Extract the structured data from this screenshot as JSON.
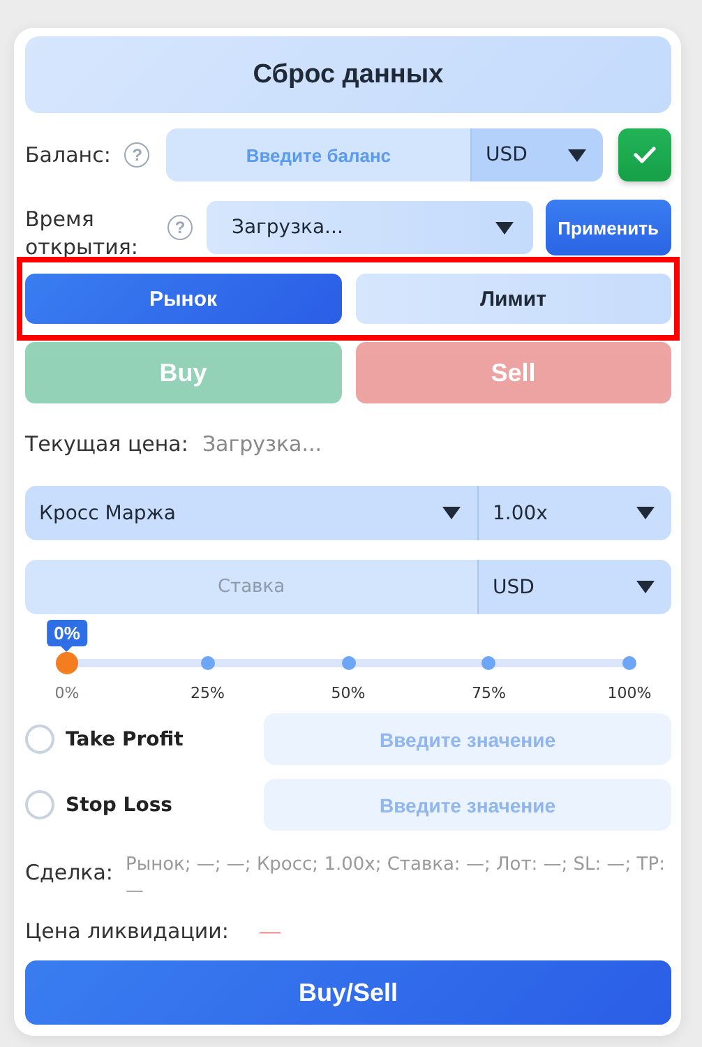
{
  "reset_button": "Сброс данных",
  "balance": {
    "label": "Баланс:",
    "help": "?",
    "placeholder": "Введите баланс",
    "currency": "USD"
  },
  "open_time": {
    "label": "Время открытия:",
    "help": "?",
    "value": "Загрузка...",
    "apply_button": "Применить"
  },
  "order_types_highlighted": true,
  "order_types": [
    {
      "label": "Рынок",
      "selected": true
    },
    {
      "label": "Лимит",
      "selected": false
    }
  ],
  "sides": [
    {
      "label": "Buy",
      "kind": "buy",
      "disabled": true
    },
    {
      "label": "Sell",
      "kind": "sell",
      "disabled": true
    }
  ],
  "current_price": {
    "label": "Текущая цена:",
    "value": "Загрузка..."
  },
  "margin": {
    "mode": "Кросс Маржа",
    "leverage": "1.00x"
  },
  "stake": {
    "placeholder": "Ставка",
    "currency": "USD"
  },
  "slider": {
    "level": 0,
    "reading": "0%",
    "ticks": [
      "0%",
      "25%",
      "50%",
      "75%",
      "100%"
    ]
  },
  "protections": [
    {
      "label": "Take Profit",
      "checked": false,
      "placeholder": "Введите значение",
      "disabled": true
    },
    {
      "label": "Stop Loss",
      "checked": false,
      "placeholder": "Введите значение",
      "disabled": true
    }
  ],
  "deal": {
    "label": "Сделка:",
    "value": "Рынок; —; —; Кросс; 1.00x; Ставка: —; Лот: —; SL: —; TP: —"
  },
  "liquidation": {
    "label": "Цена ликвидации:",
    "value": "—"
  },
  "submit_button": "Buy/Sell"
}
